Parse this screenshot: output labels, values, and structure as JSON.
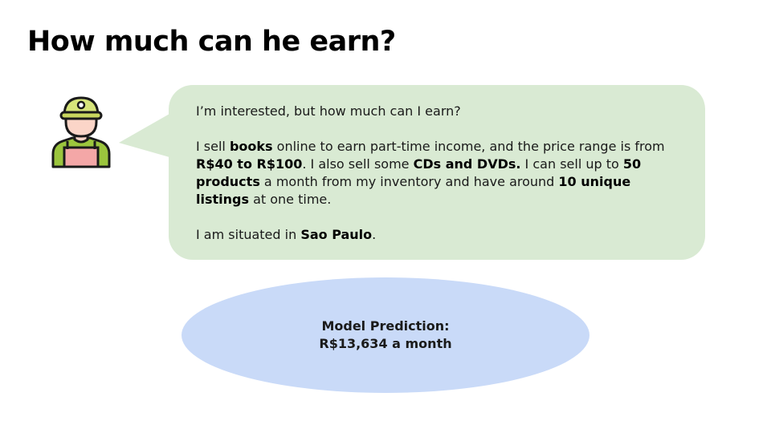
{
  "title": "How much can he earn?",
  "avatar": {
    "icon": "worker-avatar-icon"
  },
  "speech": {
    "line1": "I’m interested, but how much can I earn?",
    "p2": {
      "t1": "I sell ",
      "b1": "books",
      "t2": " online to earn part-time income, and the price range is from ",
      "b2": "R$40 to R$100",
      "t3": ". I also sell some ",
      "b3": "CDs and DVDs.",
      "t4": " I can sell up to ",
      "b4": "50 products",
      "t5": " a month from my inventory and have around ",
      "b5": "10 unique listings",
      "t6": " at one time."
    },
    "p3": {
      "t1": "I am situated in ",
      "b1": "Sao Paulo",
      "t2": "."
    }
  },
  "prediction": {
    "label": "Model Prediction:",
    "value": "R$13,634 a month"
  },
  "colors": {
    "bubble": "#d9ead3",
    "ellipse": "#c9daf8",
    "avatar_cap": "#d6e47a",
    "avatar_skin": "#fbd5c8",
    "avatar_shirt": "#9bc53d",
    "avatar_overalls": "#f4a7a7"
  }
}
